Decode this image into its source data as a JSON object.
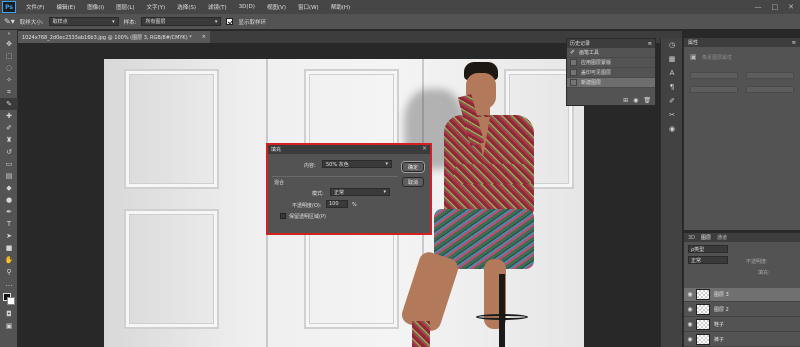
{
  "menubar": {
    "logo": "Ps",
    "items": [
      "文件(F)",
      "编辑(E)",
      "图像(I)",
      "图层(L)",
      "文字(Y)",
      "选择(S)",
      "滤镜(T)",
      "3D(D)",
      "视图(V)",
      "窗口(W)",
      "帮助(H)"
    ],
    "window_controls": [
      "—",
      "□",
      "✕"
    ]
  },
  "optbar": {
    "sample_size_label": "取样大小:",
    "sample_size_value": "取样点",
    "sample_label": "样本:",
    "sample_value": "所有图层",
    "show_ring_label": "显示取样环"
  },
  "document": {
    "tab_label": "1024x768_2d0ec2333ab16b3.jpg @ 100% (图层 3, RGB/8#/CMYK) *",
    "tab_close": "×"
  },
  "fill_dialog": {
    "title": "填充",
    "close": "×",
    "contents_label": "内容:",
    "contents_value": "50% 灰色",
    "blending_group": "混合",
    "mode_label": "模式:",
    "mode_value": "正常",
    "opacity_label": "不透明度(O):",
    "opacity_value": "100",
    "opacity_unit": "%",
    "preserve_label": "保留透明区域(P)",
    "ok_label": "确定",
    "cancel_label": "取消"
  },
  "history_panel": {
    "title": "历史记录",
    "menu": "≡",
    "items": [
      {
        "label": "画笔工具",
        "icon": "brush-icon"
      },
      {
        "label": "应用图层蒙版",
        "icon": "layer-box-icon"
      },
      {
        "label": "盖印可见图层",
        "icon": "layer-box-icon"
      },
      {
        "label": "新建图层",
        "icon": "layer-box-icon",
        "selected": true
      }
    ],
    "footer_icons": [
      "⊞",
      "◉",
      "🗑"
    ]
  },
  "props_panel": {
    "title": "属性",
    "menu": "≡",
    "ghost_label": "像素图层属性"
  },
  "layers_panel": {
    "tabs": [
      "3D",
      "图层",
      "通道"
    ],
    "filter_label": "ρ类型",
    "blend_mode": "正常",
    "opacity_label": "不透明度:",
    "fill_label": "填充:",
    "layers": [
      {
        "name": "图层 3",
        "selected": true,
        "thumb": "transparent"
      },
      {
        "name": "图层 2",
        "selected": false,
        "thumb": "transparent"
      },
      {
        "name": "鞋子",
        "selected": false,
        "thumb": "transparent"
      },
      {
        "name": "裤子",
        "selected": false,
        "thumb": "transparent"
      }
    ]
  },
  "colors": {
    "accent": "#31a8ff",
    "dialog_highlight": "#d32121"
  }
}
